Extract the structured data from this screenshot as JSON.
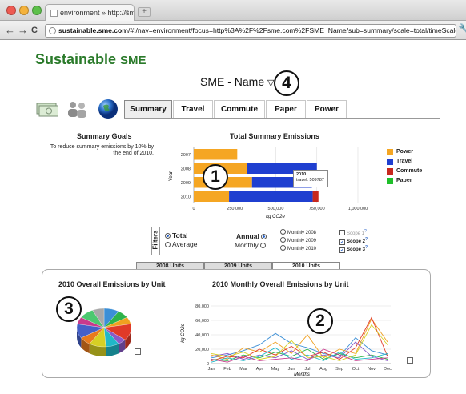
{
  "browser": {
    "tab_title": "environment » http://sme...",
    "tab_close": "×",
    "new_tab": "+",
    "url_host": "sustainable.sme.com",
    "url_path": "/#!/nav=environment/focus=http%3A%2F%2Fsme.com%2FSME_Name/sub=summary/scale=total/timeScale=annual/s",
    "back": "←",
    "forward": "→",
    "reload": "C",
    "wrench": "🔧"
  },
  "brand": {
    "name": "Sustainable",
    "suffix": "SME"
  },
  "page_title": {
    "text": "SME - Name",
    "arrow": "▽"
  },
  "callouts": {
    "c1": "1",
    "c2": "2",
    "c3": "3",
    "c4": "4"
  },
  "nav_tabs": [
    "Summary",
    "Travel",
    "Commute",
    "Paper",
    "Power"
  ],
  "active_tab": "Summary",
  "goals": {
    "title": "Summary Goals",
    "text": "To reduce summary emissions by 10% by the end of 2010."
  },
  "summary_chart": {
    "title": "Total Summary Emissions",
    "ylabel": "Year",
    "xlabel": "kg CO2e",
    "tooltip_year": "2010",
    "tooltip_value": "travel: 509787"
  },
  "legend": [
    {
      "label": "Power",
      "color": "#f5a623"
    },
    {
      "label": "Travel",
      "color": "#1f3fd0"
    },
    {
      "label": "Commute",
      "color": "#c8281e"
    },
    {
      "label": "Paper",
      "color": "#1fbf2a"
    }
  ],
  "filters": {
    "label": "Filters",
    "total": "Total",
    "average": "Average",
    "annual": "Annual",
    "monthly": "Monthly",
    "months": [
      "Monthly 2008",
      "Monthly 2009",
      "Monthly 2010"
    ],
    "scopes": [
      {
        "label": "Scope 1",
        "sup": "?",
        "checked": false
      },
      {
        "label": "Scope 2",
        "sup": "?",
        "checked": true
      },
      {
        "label": "Scope 3",
        "sup": "?",
        "checked": true
      }
    ]
  },
  "unit_tabs": [
    "2008 Units",
    "2009 Units",
    "2010 Units"
  ],
  "active_unit_tab": "2010 Units",
  "pie_panel": {
    "title": "2010 Overall Emissions by Unit"
  },
  "line_panel": {
    "title": "2010 Monthly Overall Emissions by Unit",
    "ylabel": "kg CO2e",
    "xlabel": "Months"
  },
  "chart_data": [
    {
      "type": "bar",
      "orientation": "horizontal",
      "stacked": true,
      "title": "Total Summary Emissions",
      "xlabel": "kg CO2e",
      "ylabel": "Year",
      "categories": [
        "2007",
        "2008",
        "2009",
        "2010"
      ],
      "xlim": [
        0,
        1000000
      ],
      "xticks": [
        "0",
        "250,000",
        "500,000",
        "750,000",
        "1,000,000"
      ],
      "series": [
        {
          "name": "Power",
          "color": "#f5a623",
          "values": [
            265000,
            325000,
            355000,
            215000
          ]
        },
        {
          "name": "Travel",
          "color": "#1f3fd0",
          "values": [
            0,
            425000,
            365000,
            509787
          ]
        },
        {
          "name": "Commute",
          "color": "#c8281e",
          "values": [
            0,
            0,
            0,
            35000
          ]
        },
        {
          "name": "Paper",
          "color": "#1fbf2a",
          "values": [
            0,
            0,
            0,
            0
          ]
        }
      ]
    },
    {
      "type": "pie",
      "title": "2010 Overall Emissions by Unit",
      "values": [
        9,
        7,
        6,
        14,
        5,
        8,
        10,
        7,
        12,
        6,
        9,
        7
      ],
      "colors": [
        "#3c8fd6",
        "#2eb34a",
        "#f0a020",
        "#e03a28",
        "#8a5ac8",
        "#20b8c8",
        "#d6d024",
        "#e87a1c",
        "#4560c8",
        "#c83a8c",
        "#4cc870",
        "#a8a8a8"
      ]
    },
    {
      "type": "line",
      "title": "2010 Monthly Overall Emissions by Unit",
      "xlabel": "Months",
      "ylabel": "kg CO2e",
      "categories": [
        "Jan",
        "Feb",
        "Mar",
        "Apr",
        "May",
        "Jun",
        "Jul",
        "Aug",
        "Sep",
        "Oct",
        "Nov",
        "Dec"
      ],
      "ylim": [
        0,
        80000
      ],
      "yticks": [
        "0",
        "20,000",
        "40,000",
        "60,000",
        "80,000"
      ],
      "series": [
        {
          "color": "#3c8fd6",
          "values": [
            8000,
            12000,
            18000,
            26000,
            42000,
            28000,
            22000,
            14000,
            10000,
            36000,
            18000,
            12000
          ]
        },
        {
          "color": "#f0a020",
          "values": [
            12000,
            6000,
            22000,
            16000,
            30000,
            14000,
            40000,
            8000,
            20000,
            14000,
            62000,
            30000
          ]
        },
        {
          "color": "#e03a28",
          "values": [
            4000,
            10000,
            8000,
            20000,
            12000,
            24000,
            10000,
            16000,
            6000,
            22000,
            64000,
            10000
          ]
        },
        {
          "color": "#2eb34a",
          "values": [
            6000,
            4000,
            12000,
            8000,
            16000,
            10000,
            20000,
            6000,
            14000,
            8000,
            12000,
            6000
          ]
        },
        {
          "color": "#8a5ac8",
          "values": [
            10000,
            14000,
            6000,
            12000,
            8000,
            18000,
            6000,
            12000,
            8000,
            30000,
            10000,
            4000
          ]
        },
        {
          "color": "#20b8c8",
          "values": [
            2000,
            8000,
            4000,
            10000,
            22000,
            6000,
            12000,
            4000,
            16000,
            6000,
            8000,
            14000
          ]
        },
        {
          "color": "#d6d024",
          "values": [
            14000,
            10000,
            16000,
            6000,
            10000,
            32000,
            8000,
            10000,
            4000,
            12000,
            54000,
            26000
          ]
        },
        {
          "color": "#c83a8c",
          "values": [
            6000,
            2000,
            10000,
            4000,
            6000,
            8000,
            4000,
            20000,
            12000,
            4000,
            6000,
            8000
          ]
        }
      ]
    }
  ]
}
